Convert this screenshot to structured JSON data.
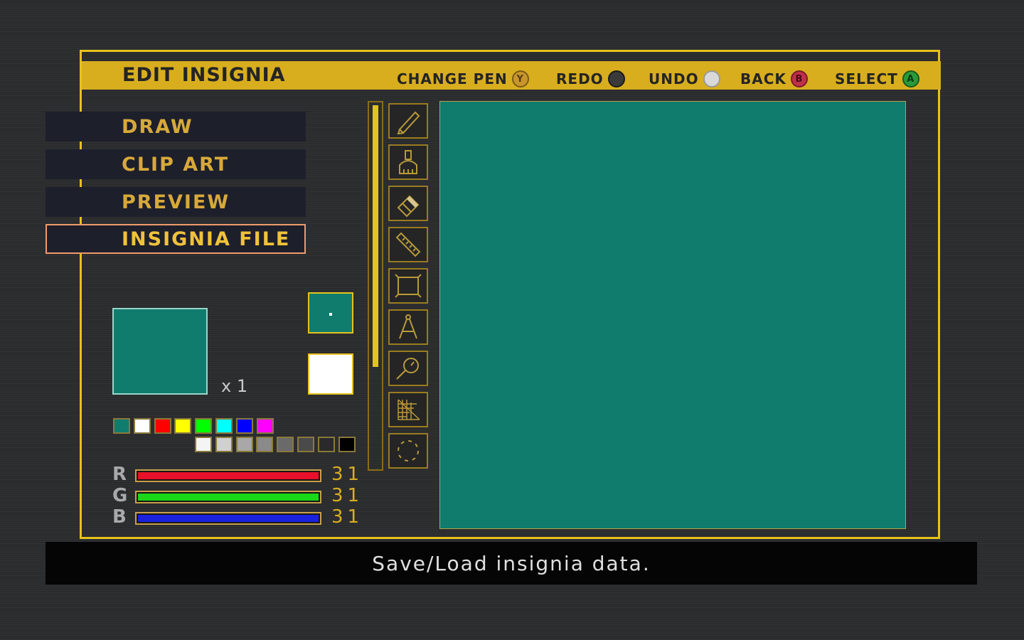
{
  "header": {
    "title": "EDIT INSIGNIA",
    "hints": [
      {
        "label": "CHANGE PEN",
        "button": "Y",
        "color": "#c9962c"
      },
      {
        "label": "REDO",
        "button": "",
        "color": "#3a3a3a"
      },
      {
        "label": "UNDO",
        "button": "",
        "color": "#d9d9d9"
      },
      {
        "label": "BACK",
        "button": "B",
        "color": "#c0304a"
      },
      {
        "label": "SELECT",
        "button": "A",
        "color": "#2a9a3a"
      }
    ]
  },
  "menu": {
    "items": [
      {
        "label": "DRAW",
        "active": false
      },
      {
        "label": "CLIP ART",
        "active": false
      },
      {
        "label": "PREVIEW",
        "active": false
      },
      {
        "label": "INSIGNIA FILE",
        "active": true
      }
    ]
  },
  "preview": {
    "multiplier": "x 1",
    "insignia_color": "#0f7c6e"
  },
  "pen": {
    "foreground_color": "#0f7c6e",
    "background_color": "#ffffff"
  },
  "palette": {
    "row1": [
      "#0f7c6e",
      "#ffffff",
      "#ff0000",
      "#ffff00",
      "#00ff00",
      "#00ffff",
      "#0000ff",
      "#ff00ff"
    ],
    "row2": [
      "#f4f4f4",
      "#d0d0d0",
      "#a8a8a8",
      "#8a8a8a",
      "#6a6a6a",
      "#4a4a4a",
      "#2a2a2a",
      "#000000"
    ]
  },
  "rgb": [
    {
      "label": "R",
      "value": "31",
      "fraction": 1.0,
      "color": "#e8102a"
    },
    {
      "label": "G",
      "value": "31",
      "fraction": 1.0,
      "color": "#18d818"
    },
    {
      "label": "B",
      "value": "31",
      "fraction": 1.0,
      "color": "#1a22e0"
    }
  ],
  "tools": [
    "pencil-icon",
    "brush-icon",
    "eraser-icon",
    "ruler-icon",
    "rectangle-icon",
    "compass-icon",
    "magnifier-icon",
    "grid-icon",
    "circle-icon"
  ],
  "canvas": {
    "color": "#0f7c6e"
  },
  "status": {
    "text": "Save/Load insignia data."
  }
}
